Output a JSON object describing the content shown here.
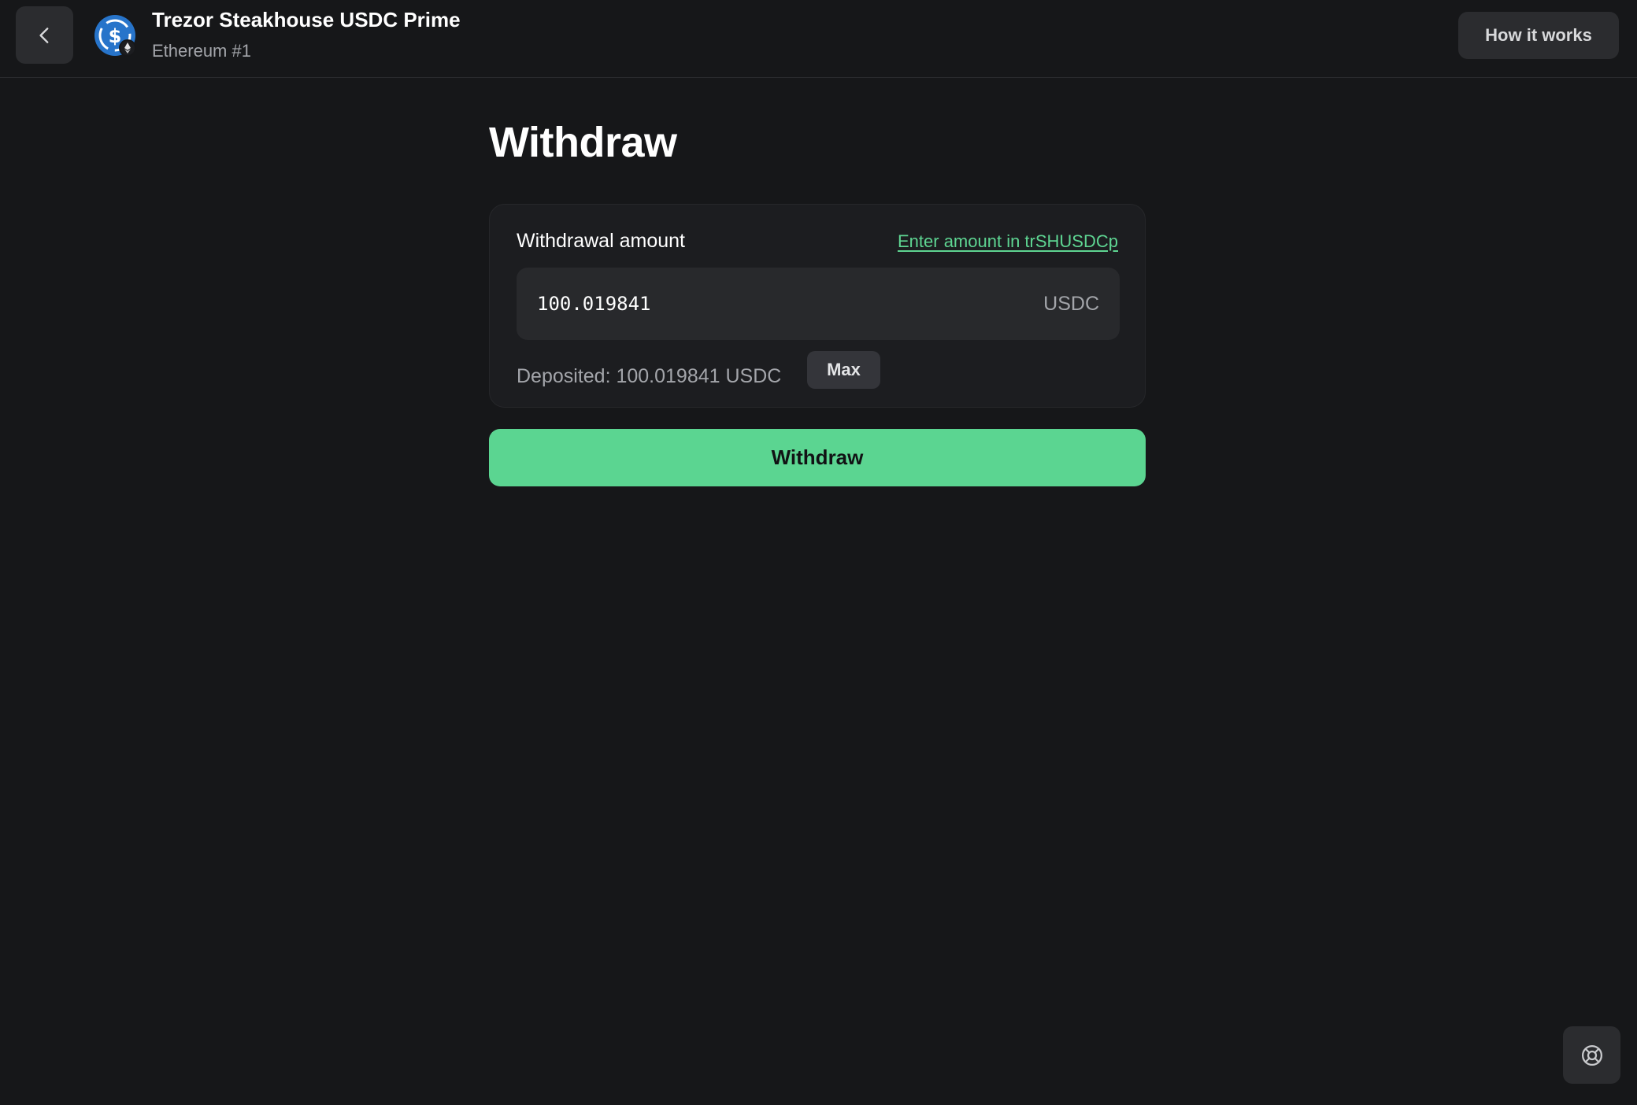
{
  "header": {
    "title": "Trezor Steakhouse USDC Prime",
    "subtitle": "Ethereum #1",
    "how_it_works_label": "How it works",
    "back_icon": "chevron-left-icon",
    "coin_icon": "usdc-coin-icon",
    "network_badge_icon": "ethereum-icon"
  },
  "main": {
    "heading": "Withdraw",
    "card": {
      "label": "Withdrawal amount",
      "alt_unit_link": "Enter amount in trSHUSDCp",
      "amount_value": "100.019841",
      "unit": "USDC",
      "deposited_text": "Deposited: 100.019841 USDC",
      "max_label": "Max"
    },
    "withdraw_label": "Withdraw"
  },
  "support": {
    "icon": "lifebuoy-icon"
  },
  "colors": {
    "background": "#161719",
    "accent_green": "#5bd591",
    "link_green": "#5ed592",
    "card": "#1c1d20",
    "input": "#28292c"
  }
}
